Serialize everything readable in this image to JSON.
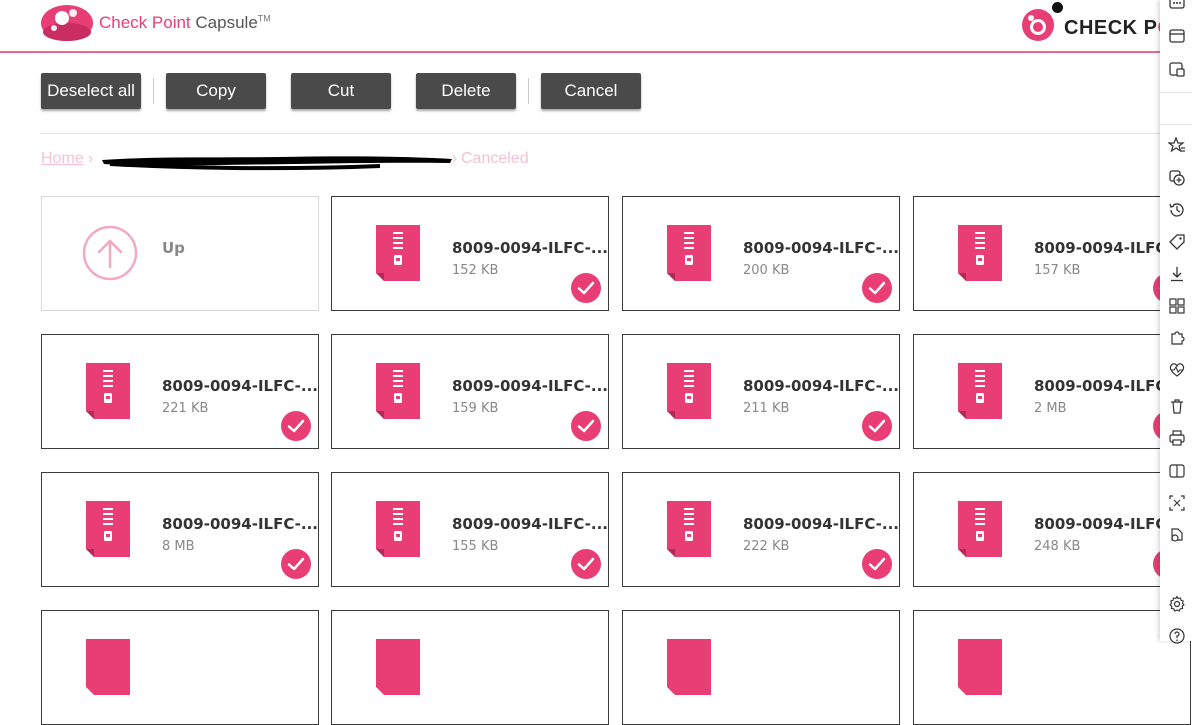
{
  "header": {
    "brand_main": "Check Point",
    "brand_sub": "Capsule",
    "brand_tm": "TM",
    "partner_text": "CHECK P",
    "partner_text_hl": "O"
  },
  "toolbar": {
    "deselect_all": "Deselect all",
    "copy": "Copy",
    "cut": "Cut",
    "delete": "Delete",
    "cancel": "Cancel"
  },
  "breadcrumb": {
    "home": "Home",
    "separator": "›",
    "current": "Canceled"
  },
  "up_tile": {
    "label": "Up"
  },
  "files": [
    {
      "name": "8009-0094-ILFC-...",
      "size": "152 KB",
      "selected": true
    },
    {
      "name": "8009-0094-ILFC-...",
      "size": "200 KB",
      "selected": true
    },
    {
      "name": "8009-0094-ILFC-...",
      "size": "157 KB",
      "selected": true
    },
    {
      "name": "8009-0094-ILFC-...",
      "size": "221 KB",
      "selected": true
    },
    {
      "name": "8009-0094-ILFC-...",
      "size": "159 KB",
      "selected": true
    },
    {
      "name": "8009-0094-ILFC-...",
      "size": "211 KB",
      "selected": true
    },
    {
      "name": "8009-0094-ILFC-...",
      "size": "2 MB",
      "selected": true
    },
    {
      "name": "8009-0094-ILFC-...",
      "size": "8 MB",
      "selected": true
    },
    {
      "name": "8009-0094-ILFC-...",
      "size": "155 KB",
      "selected": true
    },
    {
      "name": "8009-0094-ILFC-...",
      "size": "222 KB",
      "selected": true
    },
    {
      "name": "8009-0094-ILFC-...",
      "size": "248 KB",
      "selected": true
    }
  ],
  "colors": {
    "accent": "#e83e75",
    "button_bg": "#4a4a4a",
    "breadcrumb": "#f6c2d2"
  },
  "sidebar_icons": [
    "more-icon",
    "tab-icon",
    "collections-icon",
    "favorites-icon",
    "copy-icon",
    "history-icon",
    "tag-icon",
    "download-icon",
    "apps-icon",
    "extensions-icon",
    "health-icon",
    "delete-icon",
    "print-icon",
    "split-screen-icon",
    "screenshot-icon",
    "share-icon",
    "settings-icon",
    "help-icon"
  ]
}
